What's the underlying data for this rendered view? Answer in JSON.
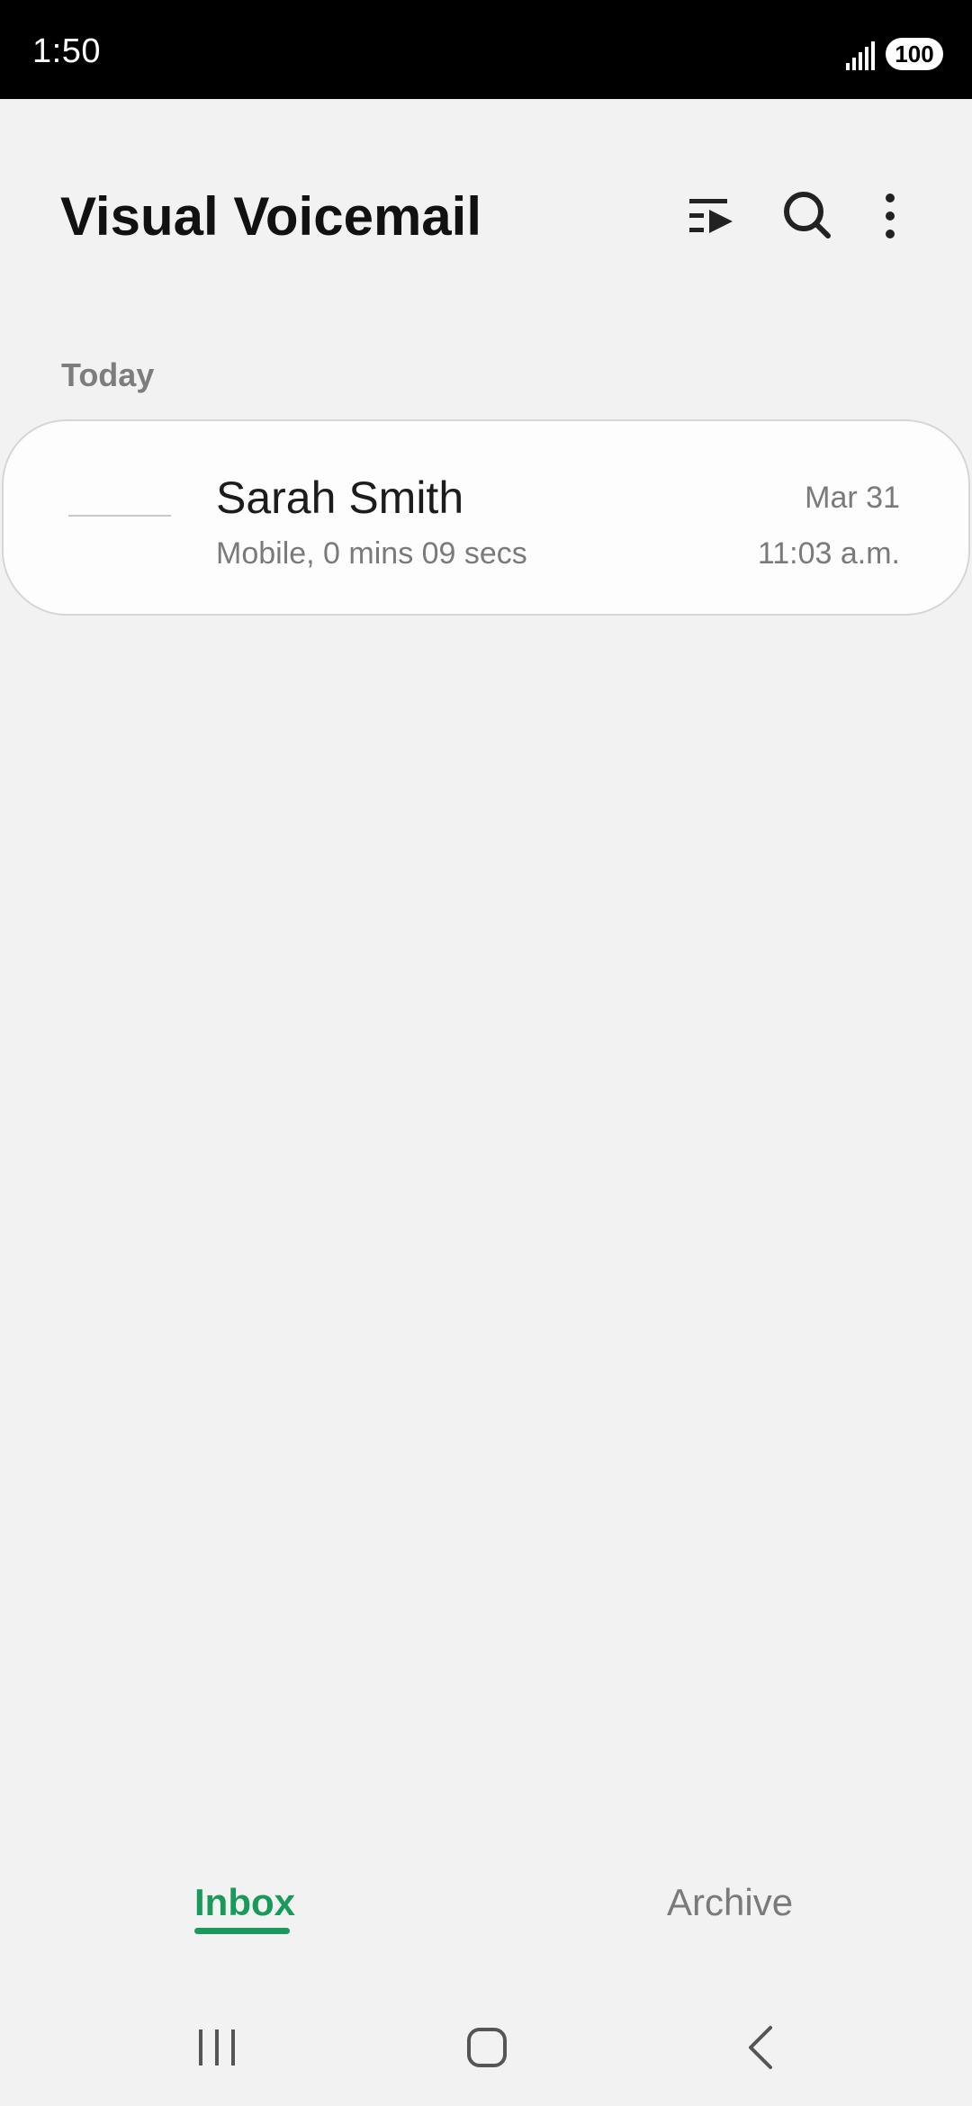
{
  "status_bar": {
    "time": "1:50",
    "battery": "100",
    "icons": [
      "signal-icon",
      "battery-icon"
    ]
  },
  "header": {
    "title": "Visual Voicemail",
    "actions": [
      "play-all-icon",
      "search-icon",
      "more-options-icon"
    ]
  },
  "sections": [
    {
      "header": "Today",
      "items": [
        {
          "name": "Sarah Smith",
          "detail": "Mobile, 0 mins 09 secs",
          "date": "Mar 31",
          "time": "11:03 a.m."
        }
      ]
    }
  ],
  "tabs": [
    {
      "label": "Inbox",
      "selected": true
    },
    {
      "label": "Archive",
      "selected": false
    }
  ],
  "nav_bar": [
    "recents-icon",
    "home-icon",
    "back-icon"
  ],
  "colors": {
    "accent": "#1a9a5a",
    "background": "#f2f2f2",
    "status_bar": "#000000"
  }
}
